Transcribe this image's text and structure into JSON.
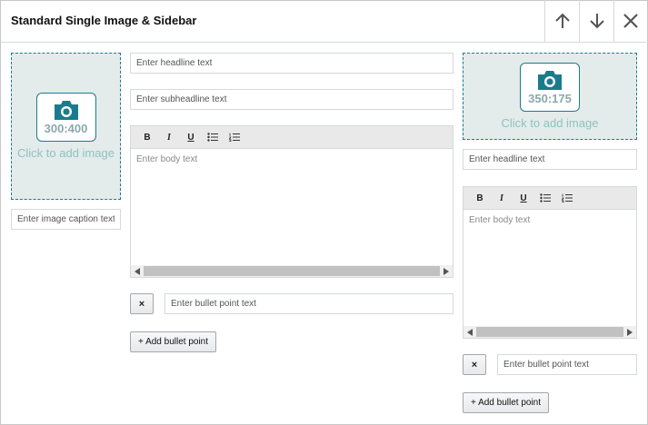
{
  "header": {
    "title": "Standard Single Image & Sidebar"
  },
  "left": {
    "image": {
      "ratio": "300:400",
      "cta": "Click to add image"
    },
    "caption_placeholder": "Enter image caption text"
  },
  "main": {
    "headline_placeholder": "Enter headline text",
    "subheadline_placeholder": "Enter subheadline text",
    "toolbar": {
      "bold": "B",
      "italic": "I",
      "underline": "U"
    },
    "body_placeholder": "Enter body text",
    "bullet_remove": "×",
    "bullet_placeholder": "Enter bullet point text",
    "add_bullet_label": "+ Add bullet point"
  },
  "sidebar": {
    "image": {
      "ratio": "350:175",
      "cta": "Click to add image"
    },
    "headline_placeholder": "Enter headline text",
    "toolbar": {
      "bold": "B",
      "italic": "I",
      "underline": "U"
    },
    "body_placeholder": "Enter body text",
    "bullet_remove": "×",
    "bullet_placeholder": "Enter bullet point text",
    "add_bullet_label": "+ Add bullet point"
  },
  "icons": {
    "move_up": "arrow-up-icon",
    "move_down": "arrow-down-icon",
    "close": "close-icon",
    "camera": "camera-icon",
    "bullet_list": "bullet-list-icon",
    "numbered_list": "numbered-list-icon"
  },
  "colors": {
    "accent": "#1b7b8c",
    "image_bg": "#e3ebeb",
    "cta_text": "#8fc3bf"
  }
}
